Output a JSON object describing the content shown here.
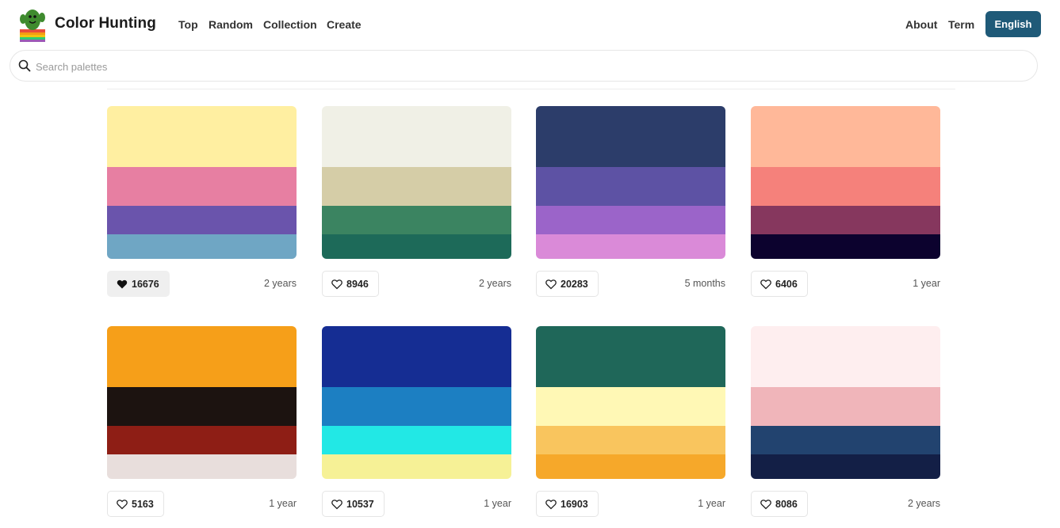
{
  "header": {
    "brand": "Color Hunting",
    "nav": [
      "Top",
      "Random",
      "Collection",
      "Create"
    ],
    "right_links": [
      "About",
      "Term"
    ],
    "language": "English"
  },
  "search": {
    "placeholder": "Search palettes",
    "value": ""
  },
  "palettes": [
    {
      "colors": [
        "#FFEFA1",
        "#E77FA2",
        "#6A54AC",
        "#6FA6C4"
      ],
      "likes": "16676",
      "age": "2 years",
      "liked": true
    },
    {
      "colors": [
        "#F0F0E6",
        "#D5CDA7",
        "#3B8461",
        "#1D6A59"
      ],
      "likes": "8946",
      "age": "2 years",
      "liked": false
    },
    {
      "colors": [
        "#2C3D6A",
        "#5D52A4",
        "#9B64C9",
        "#DA8AD8"
      ],
      "likes": "20283",
      "age": "5 months",
      "liked": false
    },
    {
      "colors": [
        "#FFB899",
        "#F5817B",
        "#86375E",
        "#0C022E"
      ],
      "likes": "6406",
      "age": "1 year",
      "liked": false
    },
    {
      "colors": [
        "#F69F19",
        "#1C1310",
        "#8E1E15",
        "#E8DEDC"
      ],
      "likes": "5163",
      "age": "1 year",
      "liked": false
    },
    {
      "colors": [
        "#152D93",
        "#1C7FC2",
        "#22E8E5",
        "#F6F196"
      ],
      "likes": "10537",
      "age": "1 year",
      "liked": false
    },
    {
      "colors": [
        "#1F6759",
        "#FFF8B5",
        "#F9C55E",
        "#F6A82A"
      ],
      "likes": "16903",
      "age": "1 year",
      "liked": false
    },
    {
      "colors": [
        "#FEEEEF",
        "#F0B5BA",
        "#22436F",
        "#131F46"
      ],
      "likes": "8086",
      "age": "2 years",
      "liked": false
    }
  ],
  "accent": "#1F5A78"
}
